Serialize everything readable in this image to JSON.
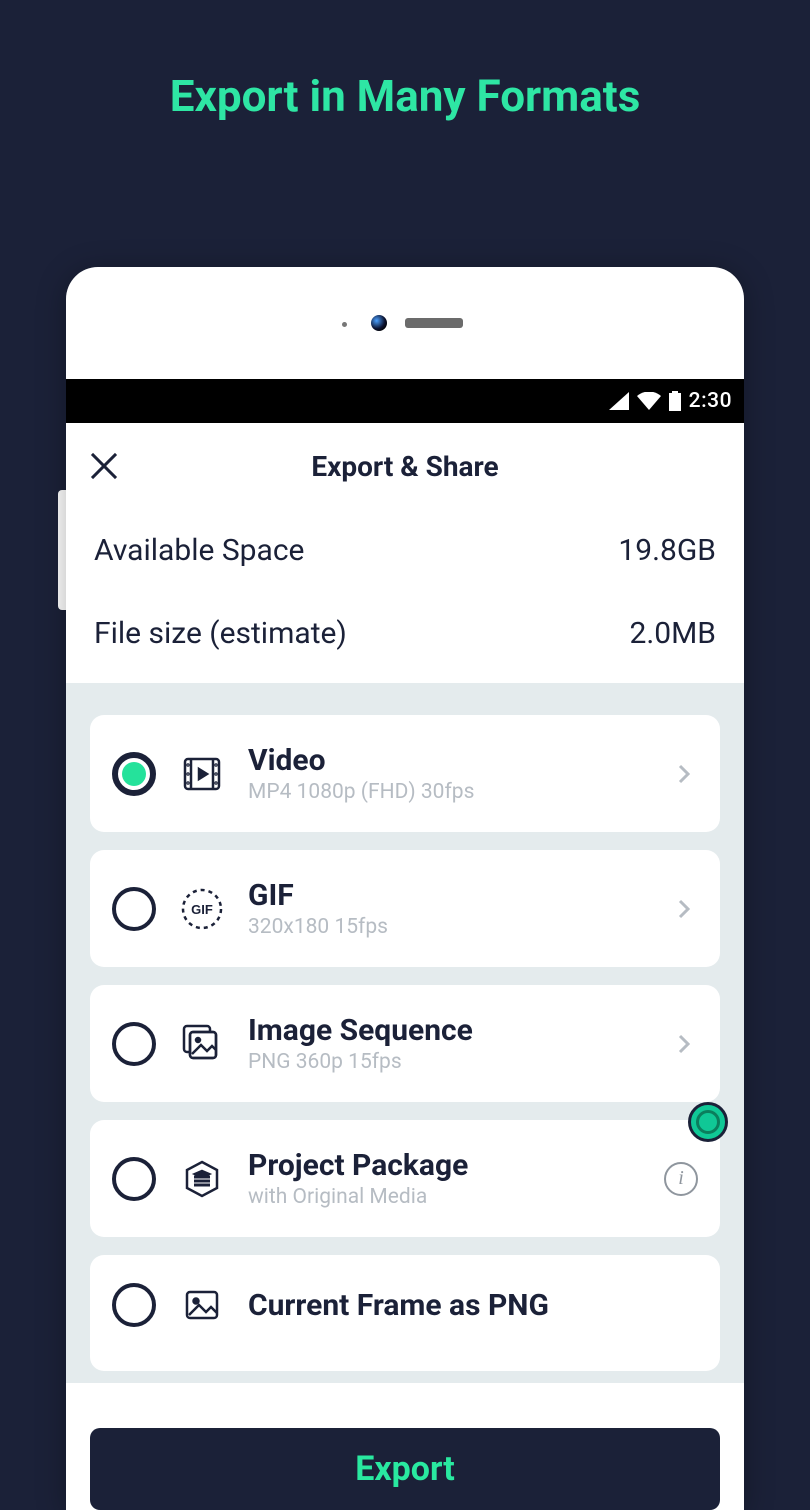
{
  "headline": "Export in Many Formats",
  "status": {
    "time": "2:30"
  },
  "header": {
    "title": "Export & Share"
  },
  "info": {
    "available_label": "Available Space",
    "available_value": "19.8GB",
    "filesize_label": "File size (estimate)",
    "filesize_value": "2.0MB"
  },
  "options": [
    {
      "title": "Video",
      "subtitle": "MP4 1080p (FHD) 30fps",
      "selected": true,
      "trailing": "chevron"
    },
    {
      "title": "GIF",
      "subtitle": "320x180 15fps",
      "selected": false,
      "trailing": "chevron"
    },
    {
      "title": "Image Sequence",
      "subtitle": "PNG 360p 15fps",
      "selected": false,
      "trailing": "chevron"
    },
    {
      "title": "Project Package",
      "subtitle": "with Original Media",
      "selected": false,
      "trailing": "info"
    },
    {
      "title": "Current Frame as PNG",
      "subtitle": "",
      "selected": false,
      "trailing": "none"
    }
  ],
  "export_button": "Export"
}
